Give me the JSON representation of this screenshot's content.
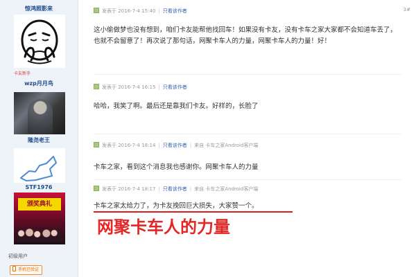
{
  "sidebar": {
    "authors": [
      {
        "name": "惊鸿照影来",
        "tag": "卡友新手"
      },
      {
        "name": "wzp月月鸟"
      },
      {
        "name": "隆尧老王"
      },
      {
        "name": "STF1976"
      }
    ],
    "event_banner": "颁奖典礼",
    "user_level": "初级用户",
    "phone_verify": "手机已验证"
  },
  "posts": [
    {
      "date": "发表于 2016-7-4 15:40",
      "author_only": "只看该作者",
      "floor": "3#",
      "text": "这小偷做梦也没有想到，咱们卡友能帮他找回车！如果没有卡友，没有卡车之家大家都不会知道车丢了，也就不会留意了！再次说了那句话，网聚卡车人的力量，网聚卡车人的力量！好！"
    },
    {
      "date": "发表于 2016-7-4 16:15",
      "author_only": "只看该作者",
      "text": "哈哈，我笑了啊。最后还是靠我们卡友。好样的，长脸了"
    },
    {
      "date": "发表于 2016-7-4 18:14",
      "author_only": "只看该作者",
      "source": "来自 卡车之家Android客户端",
      "text": "卡车之家，看到这个消息我也感谢你。网聚卡车人的力量"
    },
    {
      "date": "发表于 2016-7-4 18:17",
      "author_only": "只看该作者",
      "source": "来自 卡车之家Android客户端",
      "text": "卡车之家太给力了，为卡友挽回巨大损失，大家赞一个。"
    }
  ],
  "caption": "网聚卡车人的力量",
  "colors": {
    "accent": "#e32626",
    "link": "#2f5fb3",
    "sidebar_bg": "#eef3f9"
  }
}
